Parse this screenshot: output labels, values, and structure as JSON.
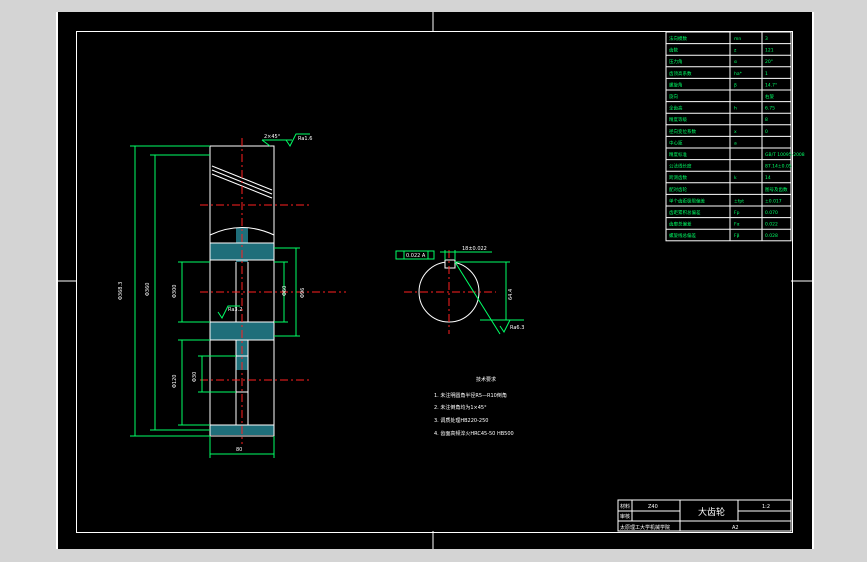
{
  "drawing": {
    "title": "大齿轮",
    "scale": "1:2",
    "sheet_size": "A2",
    "material_label": "材料",
    "material_value": "Z40",
    "check_label": "审核",
    "school": "太原理工大学机械学院"
  },
  "notes": {
    "heading": "技术要求",
    "items": [
      "1. 未注明圆角半径R5—R10倒角",
      "2. 未注倒角均为1×45°",
      "3. 调质处理HB220-250",
      "4. 齿面高频淬火HRC45-50 HB500"
    ]
  },
  "param_table": [
    {
      "name": "法向模数",
      "sym": "mn",
      "val": "3"
    },
    {
      "name": "齿数",
      "sym": "z",
      "val": "121"
    },
    {
      "name": "压力角",
      "sym": "α",
      "val": "20°"
    },
    {
      "name": "齿顶高系数",
      "sym": "ha*",
      "val": "1"
    },
    {
      "name": "螺旋角",
      "sym": "β",
      "val": "14.7°"
    },
    {
      "name": "旋向",
      "sym": "",
      "val": "右旋"
    },
    {
      "name": "全齿高",
      "sym": "h",
      "val": "6.75"
    },
    {
      "name": "精度等级",
      "sym": "",
      "val": "8"
    },
    {
      "name": "径向变位系数",
      "sym": "x",
      "val": "0"
    },
    {
      "name": "中心距",
      "sym": "a",
      "val": ""
    },
    {
      "name": "精度标准",
      "sym": "",
      "val": "GB/T 10095-2008"
    },
    {
      "name": "公法线长度",
      "sym": "",
      "val": "87.14±0.05"
    },
    {
      "name": "跨测齿数",
      "sym": "k",
      "val": "14"
    },
    {
      "name": "配对齿轮",
      "sym": "",
      "val": "图号及齿数"
    },
    {
      "name": "单个齿距极限偏差",
      "sym": "±fpt",
      "val": "±0.017"
    },
    {
      "name": "齿距累积总偏差",
      "sym": "Fp",
      "val": "0.070"
    },
    {
      "name": "齿廓总偏差",
      "sym": "Fα",
      "val": "0.022"
    },
    {
      "name": "螺旋线总偏差",
      "sym": "Fβ",
      "val": "0.028"
    }
  ],
  "dims": {
    "d_tip": "Φ368.3",
    "d_pitch": "Φ360",
    "d_bore": "Φ60",
    "d_hub": "Φ96",
    "d_web": "Φ300",
    "d_hole": "Φ30",
    "d_root": "Φ120",
    "width": "80",
    "chamfer": "2×45°",
    "rough_1": "Ra1.6",
    "rough_2": "Ra3.2",
    "rough_3": "Ra6.3",
    "keyway_width": "18±0.022",
    "keyway_depth": "64.4",
    "tol_frame": "0.022 A",
    "datum": "A"
  },
  "colors": {
    "outline": "#ffffff",
    "dimension": "#00ff66",
    "center": "#ff2020",
    "hatch": "#3399aa",
    "text": "#ffff66"
  }
}
